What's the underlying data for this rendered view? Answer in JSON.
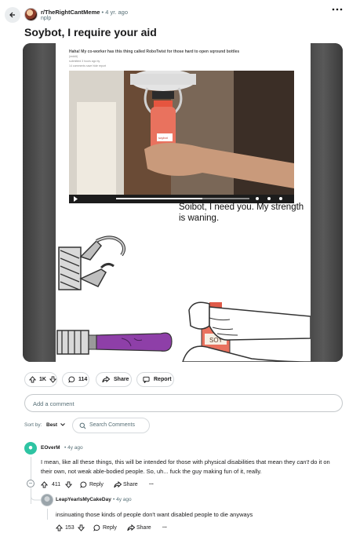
{
  "post": {
    "subreddit": "r/TheRightCantMeme",
    "separator": "•",
    "age": "4 yr. ago",
    "author": "nplp",
    "title": "Soybot, I require your aid"
  },
  "meme": {
    "screenshot_title": "Haha! My co-worker has this thing called RoboTwist for those hard to open sqround bottles",
    "screenshot_meta": "(reddit)",
    "screenshot_submitted": "submitted 3 hours ago by",
    "screenshot_comments": "14 comments  save  hide  report",
    "bottle_label": "soybot",
    "caption": "Soibot, I need you. My strength is waning.",
    "soy_label": "SOY"
  },
  "actions": {
    "votes": "1K",
    "comments": "114",
    "share": "Share",
    "report": "Report"
  },
  "comment_box": {
    "placeholder": "Add a comment"
  },
  "sort": {
    "label": "Sort by:",
    "value": "Best",
    "search": "Search Comments"
  },
  "comments": [
    {
      "user": "EOverM",
      "age": "• 4y ago",
      "text_a": "I mean, like all these things, this will be intended for those with physical disabilities that mean they ",
      "text_em": "can't",
      "text_b": " do it on their own, not weak able-bodied people. So, uh... fuck the guy making fun of it, really.",
      "votes": "411",
      "reply": "Reply",
      "share": "Share",
      "more": "...",
      "collapse": "−"
    },
    {
      "user": "LeapYearIsMyCakeDay",
      "age": "• 4y ago",
      "text": "insinuating those kinds of people don't want disabled people to die anyways",
      "votes": "153",
      "reply": "Reply",
      "share": "Share",
      "more": "..."
    }
  ],
  "colors": {
    "accent": "#0079d3",
    "muted": "#576f76",
    "border": "#d5d9dc",
    "bottle": "#e9725e",
    "dildo": "#8e3fa8"
  },
  "icons": [
    "back-arrow-icon",
    "more-icon",
    "upvote-icon",
    "downvote-icon",
    "comment-icon",
    "share-icon",
    "report-icon",
    "search-icon",
    "chevron-down-icon",
    "avatar-icon"
  ]
}
